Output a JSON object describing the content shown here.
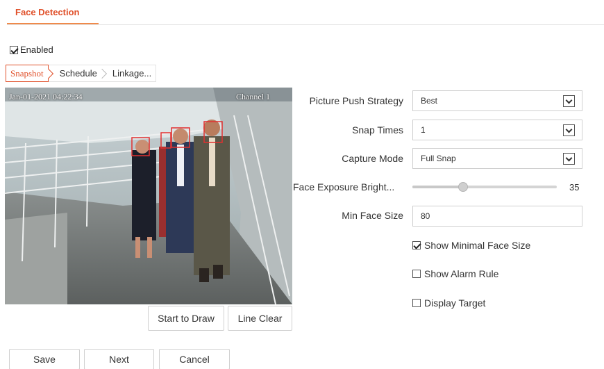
{
  "header": {
    "title": "Face Detection"
  },
  "enabled": {
    "label": "Enabled",
    "checked": true
  },
  "steps": [
    {
      "label": "Snapshot",
      "active": true
    },
    {
      "label": "Schedule",
      "active": false
    },
    {
      "label": "Linkage...",
      "active": false
    }
  ],
  "video": {
    "osd_time": "Jan-01-2021 04:22:34",
    "osd_channel": "Channel 1"
  },
  "draw_buttons": {
    "start": "Start to Draw",
    "clear": "Line Clear"
  },
  "form": {
    "push_strategy": {
      "label": "Picture Push Strategy",
      "value": "Best"
    },
    "snap_times": {
      "label": "Snap Times",
      "value": "1"
    },
    "capture_mode": {
      "label": "Capture Mode",
      "value": "Full Snap"
    },
    "exposure": {
      "label": "Face Exposure Bright...",
      "value": "35"
    },
    "min_face_size": {
      "label": "Min Face Size",
      "value": "80"
    },
    "show_minimal": {
      "label": "Show Minimal Face Size",
      "checked": true
    },
    "show_alarm": {
      "label": "Show Alarm Rule",
      "checked": false
    },
    "display_target": {
      "label": "Display Target",
      "checked": false
    }
  },
  "footer": {
    "save": "Save",
    "next": "Next",
    "cancel": "Cancel"
  },
  "colors": {
    "accent": "#e0502a",
    "underline": "#f08a4b",
    "face_box": "#e23030"
  }
}
